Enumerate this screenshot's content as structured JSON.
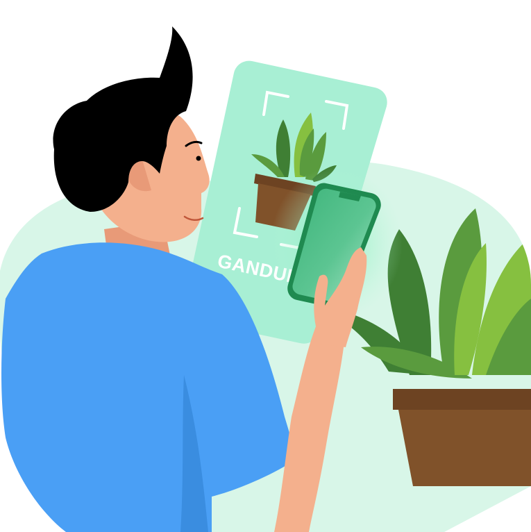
{
  "scan_card": {
    "plant_name": "GANDUL"
  },
  "colors": {
    "background_blob": "#d8f6e8",
    "scan_card": "#a8efd4",
    "shirt": "#4a9ff5",
    "skin": "#f4b08d",
    "hair": "#000000",
    "pot": "#80522a",
    "phone_frame": "#1f8a50",
    "leaf_dark": "#3f7f34",
    "leaf_mid": "#5a9b3e",
    "leaf_light": "#86c040"
  },
  "icons": {
    "scan_corners": "viewfinder-corners-icon"
  }
}
